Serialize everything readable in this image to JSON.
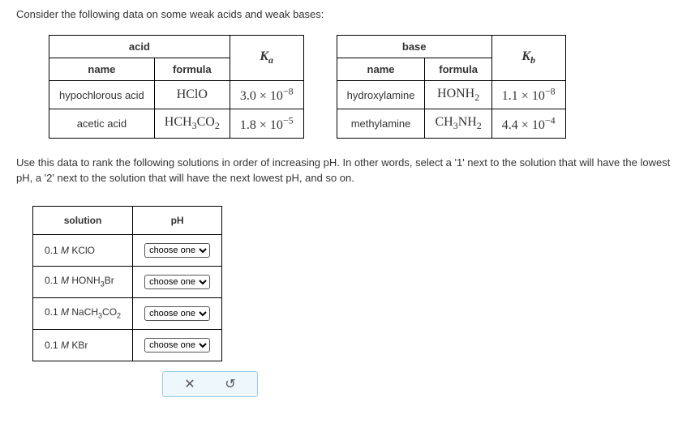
{
  "intro": "Consider the following data on some weak acids and weak bases:",
  "acid_table": {
    "header_group": "acid",
    "col_name": "name",
    "col_formula": "formula",
    "col_k_base": "K",
    "col_k_sub": "a",
    "rows": [
      {
        "name": "hypochlorous acid",
        "formula_html": "HClO",
        "k_base": "3.0 × 10",
        "k_exp": "−8"
      },
      {
        "name": "acetic acid",
        "formula_html": "HCH3CO2",
        "k_base": "1.8 × 10",
        "k_exp": "−5"
      }
    ]
  },
  "base_table": {
    "header_group": "base",
    "col_name": "name",
    "col_formula": "formula",
    "col_k_base": "K",
    "col_k_sub": "b",
    "rows": [
      {
        "name": "hydroxylamine",
        "formula_html": "HONH2",
        "k_base": "1.1 × 10",
        "k_exp": "−8"
      },
      {
        "name": "methylamine",
        "formula_html": "CH3NH2",
        "k_base": "4.4 × 10",
        "k_exp": "−4"
      }
    ]
  },
  "instruction": "Use this data to rank the following solutions in order of increasing pH. In other words, select a '1' next to the solution that will have the lowest pH, a '2' next to the solution that will have the next lowest pH, and so on.",
  "solution_table": {
    "col_solution": "solution",
    "col_ph": "pH",
    "select_placeholder": "choose one",
    "rows": [
      {
        "label_html": "0.1 M KClO"
      },
      {
        "label_html": "0.1 M HONH3Br"
      },
      {
        "label_html": "0.1 M NaCH3CO2"
      },
      {
        "label_html": "0.1 M KBr"
      }
    ]
  },
  "actions": {
    "close": "✕",
    "reset": "↺"
  }
}
